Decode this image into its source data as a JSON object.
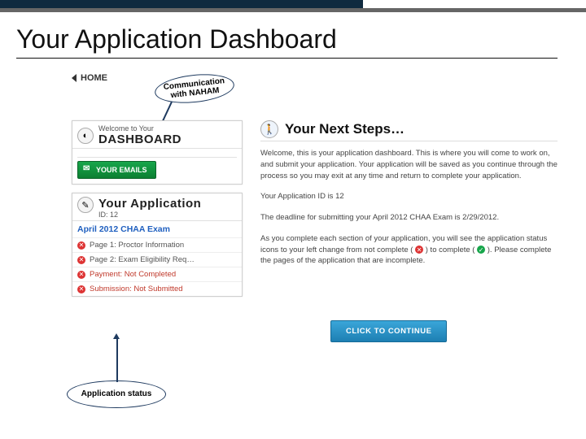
{
  "slide_title": "Your Application Dashboard",
  "home": {
    "label": "HOME"
  },
  "annotations": {
    "communication": "Communication with NAHAM",
    "application_status": "Application status"
  },
  "dashboard_panel": {
    "pre": "Welcome to Your",
    "title": "DASHBOARD",
    "emails_button": "YOUR EMAILS"
  },
  "application_panel": {
    "title": "Your Application",
    "id_label": "ID: 12",
    "exam_title": "April 2012 CHAA Exam",
    "steps": {
      "s1": "Page 1: Proctor Information",
      "s2": "Page 2: Exam Eligibility Req…",
      "s3": "Payment: Not Completed",
      "s4": "Submission: Not Submitted"
    }
  },
  "next_steps": {
    "title": "Your Next Steps…",
    "p1": "Welcome, this is your application dashboard. This is where you will come to work on, and submit your application. Your application will be saved as you continue through the process so you may exit at any time and return to complete your application.",
    "p2": "Your Application ID is 12",
    "p3_a": "The deadline for submitting your April 2012 CHAA Exam is 2/29/2012.",
    "p4_a": "As you complete each section of your application, you will see the application status icons to your left change from not complete (",
    "p4_b": ") to complete (",
    "p4_c": "). Please complete the pages of the application that are incomplete.",
    "continue_button": "CLICK TO CONTINUE"
  }
}
